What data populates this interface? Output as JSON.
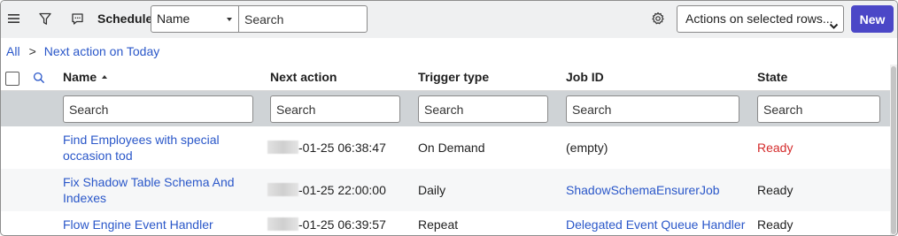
{
  "header": {
    "title": "Schedule",
    "field_select_value": "Name",
    "search_placeholder": "Search",
    "actions_label": "Actions on selected rows...",
    "new_label": "New",
    "accent_color": "#4b47c7"
  },
  "icons": [
    "hamburger-menu-icon",
    "filter-icon",
    "chat-icon",
    "gear-icon",
    "chevron-down-icon",
    "magnifier-icon"
  ],
  "breadcrumb": {
    "root": "All",
    "separator": ">",
    "current": "Next action on Today"
  },
  "table": {
    "columns": [
      {
        "label": "Name",
        "sorted": "ascending"
      },
      {
        "label": "Next action"
      },
      {
        "label": "Trigger type"
      },
      {
        "label": "Job ID"
      },
      {
        "label": "State"
      }
    ],
    "search_placeholder": "Search",
    "rows": [
      {
        "name_line1": "Find Employees with special",
        "name_line2": "occasion tod",
        "next_action": "-01-25 06:38:47",
        "trigger_type": "On Demand",
        "job_id": "(empty)",
        "state": "Ready",
        "state_color": "#d42b2b"
      },
      {
        "name_line1": "Fix Shadow Table Schema And",
        "name_line2": "Indexes",
        "next_action": "-01-25 22:00:00",
        "trigger_type": "Daily",
        "job_id": "ShadowSchemaEnsurerJob",
        "state": "Ready"
      },
      {
        "name_line1": "Flow Engine Event Handler",
        "next_action": "-01-25 06:39:57",
        "trigger_type": "Repeat",
        "job_id": "Delegated Event Queue Handler",
        "state": "Ready"
      }
    ]
  }
}
